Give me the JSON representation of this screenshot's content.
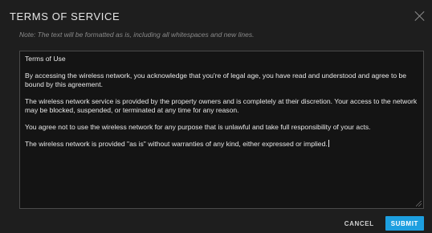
{
  "dialog": {
    "title": "TERMS OF SERVICE",
    "close_icon": "close-icon",
    "note": "Note: The text will be formatted as is, including all whitespaces and new lines.",
    "terms_text": "Terms of Use\n\nBy accessing the wireless network, you acknowledge that you're of legal age, you have read and understood and agree to be bound by this agreement.\n\nThe wireless network service is provided by the property owners and is completely at their discretion. Your access to the network may be blocked, suspended, or terminated at any time for any reason.\n\nYou agree not to use the wireless network for any purpose that is unlawful and take full responsibility of your acts.\n\nThe wireless network is provided \"as is\" without warranties of any kind, either expressed or implied.",
    "cancel_label": "CANCEL",
    "submit_label": "SUBMIT"
  },
  "colors": {
    "background": "#1e1e1e",
    "textarea_background": "#141414",
    "accent": "#1d9fe0",
    "muted_text": "#8a8a8a"
  }
}
